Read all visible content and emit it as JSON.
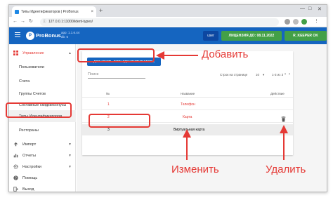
{
  "browser": {
    "tab_title": "Типы Идентификаторов | ProBonus",
    "url": "127.0.0.1:11000/ident-types/",
    "new_tab": "+",
    "close_tab": "×"
  },
  "appbar": {
    "brand": "ProBonus",
    "version_line1": "app: 1.1.6.44",
    "version_line2": "db: 6",
    "user_button": "user",
    "license_button": "ЛИЦЕНЗИЯ ДО: 08.11.2022",
    "rkeeper_button": "R_KEEPER OK"
  },
  "sidebar": {
    "items": [
      {
        "label": "Управление",
        "icon": "grid-icon"
      },
      {
        "label": "Пользователи"
      },
      {
        "label": "Счета"
      },
      {
        "label": "Группы Счетов"
      },
      {
        "label": "Составные скидки/Бонусы"
      },
      {
        "label": "Типы Идентификаторов"
      },
      {
        "label": "Рестораны"
      },
      {
        "label": "Импорт",
        "icon": "upload-icon"
      },
      {
        "label": "Отчеты",
        "icon": "chart-icon"
      },
      {
        "label": "Настройки",
        "icon": "gear-icon"
      },
      {
        "label": "Помощь",
        "icon": "help-icon"
      },
      {
        "label": "Выход",
        "icon": "logout-icon"
      }
    ]
  },
  "toolbar": {
    "add_button": "ДОБАВИТЬ ТИП ИДЕНТИФИКАТОРА",
    "search_placeholder": "Поиск",
    "rows_per_page_label": "Строк на странице",
    "rows_per_page_value": "10",
    "page_info": "1-3 из 3"
  },
  "table": {
    "headers": [
      "№",
      "Название",
      "Действие"
    ],
    "rows": [
      {
        "num": "1",
        "name": "Телефон"
      },
      {
        "num": "2",
        "name": "Карта"
      },
      {
        "num": "3",
        "name": "Виртуальная карта"
      }
    ]
  },
  "annotations": {
    "add": "Добавить",
    "edit": "Изменить",
    "delete": "Удалить"
  },
  "colors": {
    "primary": "#1565c0",
    "success": "#43a047",
    "annotation": "#e53935"
  }
}
